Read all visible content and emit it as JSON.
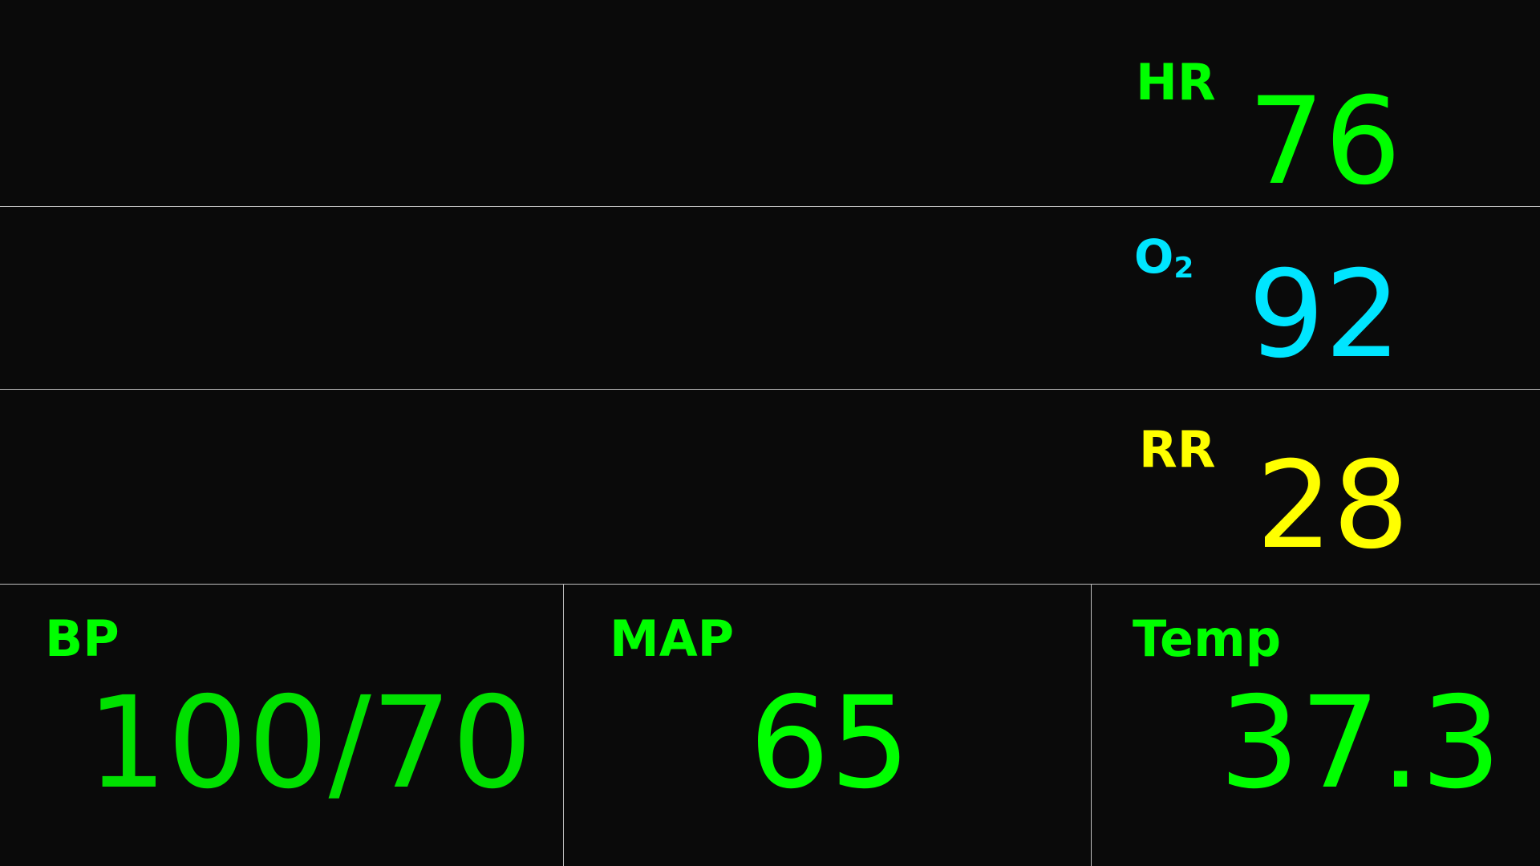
{
  "colors": {
    "background": "#0a0a0a",
    "divider": "#bfbfbf",
    "hr": "#00ff00",
    "o2": "#00e5ff",
    "rr": "#ffff00",
    "bp": "#00e000",
    "map": "#00ff00",
    "temp": "#00ff00"
  },
  "vitals": {
    "hr": {
      "label": "HR",
      "value": "76"
    },
    "o2": {
      "label": "O",
      "label_sub": "2",
      "value": "92"
    },
    "rr": {
      "label": "RR",
      "value": "28"
    },
    "bp": {
      "label": "BP",
      "value": "100/70"
    },
    "map": {
      "label": "MAP",
      "value": "65"
    },
    "temp": {
      "label": "Temp",
      "value": "37.3"
    }
  }
}
